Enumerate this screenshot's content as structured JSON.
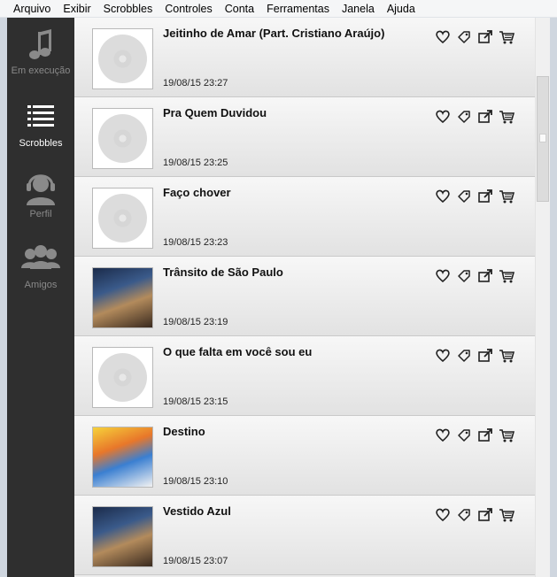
{
  "menu": [
    "Arquivo",
    "Exibir",
    "Scrobbles",
    "Controles",
    "Conta",
    "Ferramentas",
    "Janela",
    "Ajuda"
  ],
  "sidebar": {
    "items": [
      {
        "label": "Em execução",
        "icon": "music-note-icon",
        "active": false
      },
      {
        "label": "Scrobbles",
        "icon": "list-icon",
        "active": true
      },
      {
        "label": "Perfil",
        "icon": "headphones-user-icon",
        "active": false
      },
      {
        "label": "Amigos",
        "icon": "friends-icon",
        "active": false
      }
    ]
  },
  "scrobbles": [
    {
      "title": "Jeitinho de Amar (Part. Cristiano Araújo)",
      "time": "19/08/15 23:27",
      "art": "placeholder-disc"
    },
    {
      "title": "Pra Quem Duvidou",
      "time": "19/08/15 23:25",
      "art": "placeholder-disc"
    },
    {
      "title": "Faço chover",
      "time": "19/08/15 23:23",
      "art": "placeholder-disc"
    },
    {
      "title": "Trânsito de São Paulo",
      "time": "19/08/15 23:19",
      "art": "album-art"
    },
    {
      "title": "O que falta em você sou eu",
      "time": "19/08/15 23:15",
      "art": "placeholder-disc"
    },
    {
      "title": "Destino",
      "time": "19/08/15 23:10",
      "art": "album-art"
    },
    {
      "title": "Vestido Azul",
      "time": "19/08/15 23:07",
      "art": "album-art"
    }
  ],
  "actions": [
    "love-icon",
    "tag-icon",
    "share-icon",
    "buy-cart-icon"
  ],
  "colors": {
    "sidebar_bg": "#2f2f2f",
    "row_bg": "#ececec",
    "active_label": "#ffffff",
    "inactive_label": "#8a8a8a"
  }
}
